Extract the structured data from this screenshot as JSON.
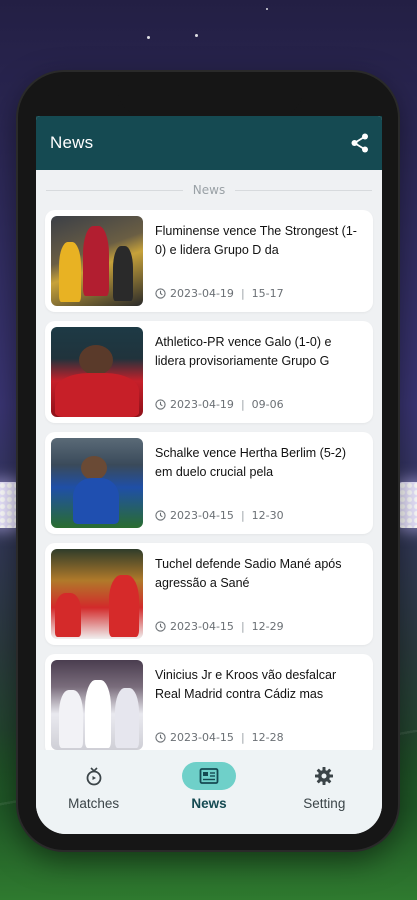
{
  "app_bar": {
    "title": "News",
    "share_icon": "share-icon"
  },
  "section": {
    "label": "News"
  },
  "news": [
    {
      "title": "Fluminense vence The Strongest (1-0) e lidera Grupo D da",
      "date": "2023-04-19",
      "time": "15-17"
    },
    {
      "title": "Athletico-PR vence Galo (1-0) e lidera provisoriamente Grupo G",
      "date": "2023-04-19",
      "time": "09-06"
    },
    {
      "title": "Schalke vence Hertha Berlim (5-2) em duelo crucial pela",
      "date": "2023-04-15",
      "time": "12-30"
    },
    {
      "title": "Tuchel defende Sadio Mané após agressão a Sané",
      "date": "2023-04-15",
      "time": "12-29"
    },
    {
      "title": "Vinicius Jr e Kroos vão desfalcar Real Madrid contra Cádiz mas",
      "date": "2023-04-15",
      "time": "12-28"
    }
  ],
  "meta_separator": "|",
  "bottom_nav": {
    "items": [
      {
        "label": "Matches",
        "icon": "tv-icon",
        "active": false
      },
      {
        "label": "News",
        "icon": "newspaper-icon",
        "active": true
      },
      {
        "label": "Setting",
        "icon": "gear-icon",
        "active": false
      }
    ]
  },
  "colors": {
    "app_bar": "#154a52",
    "active_nav_pill": "#6fd0c9",
    "screen_background": "#eff1f3"
  }
}
